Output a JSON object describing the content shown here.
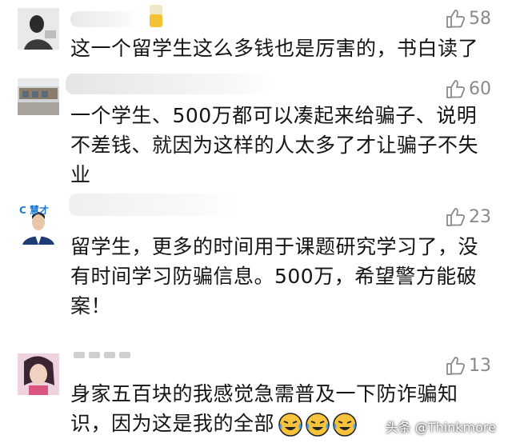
{
  "comments": [
    {
      "likes": "58",
      "text": "这一个留学生这么多钱也是厉害的，书白读了"
    },
    {
      "likes": "60",
      "text": "一个学生、500万都可以凑起来给骗子、说明不差钱、就因为这样的人太多了才让骗子不失业"
    },
    {
      "likes": "23",
      "avatar_label": "C 慧才",
      "text": "留学生，更多的时间用于课题研究学习了，没有时间学习防骗信息。500万，希望警方能破案！"
    },
    {
      "likes": "13",
      "text": "身家五百块的我感觉急需普及一下防诈骗知识，因为这是我的全部"
    }
  ],
  "watermark": "头条 @Thinkmore",
  "icons": {
    "like": "thumbs-up-icon",
    "emoji": "crying-laughing-emoji-icon"
  },
  "colors": {
    "like_gray": "#8a8a8a",
    "text": "#141414"
  }
}
